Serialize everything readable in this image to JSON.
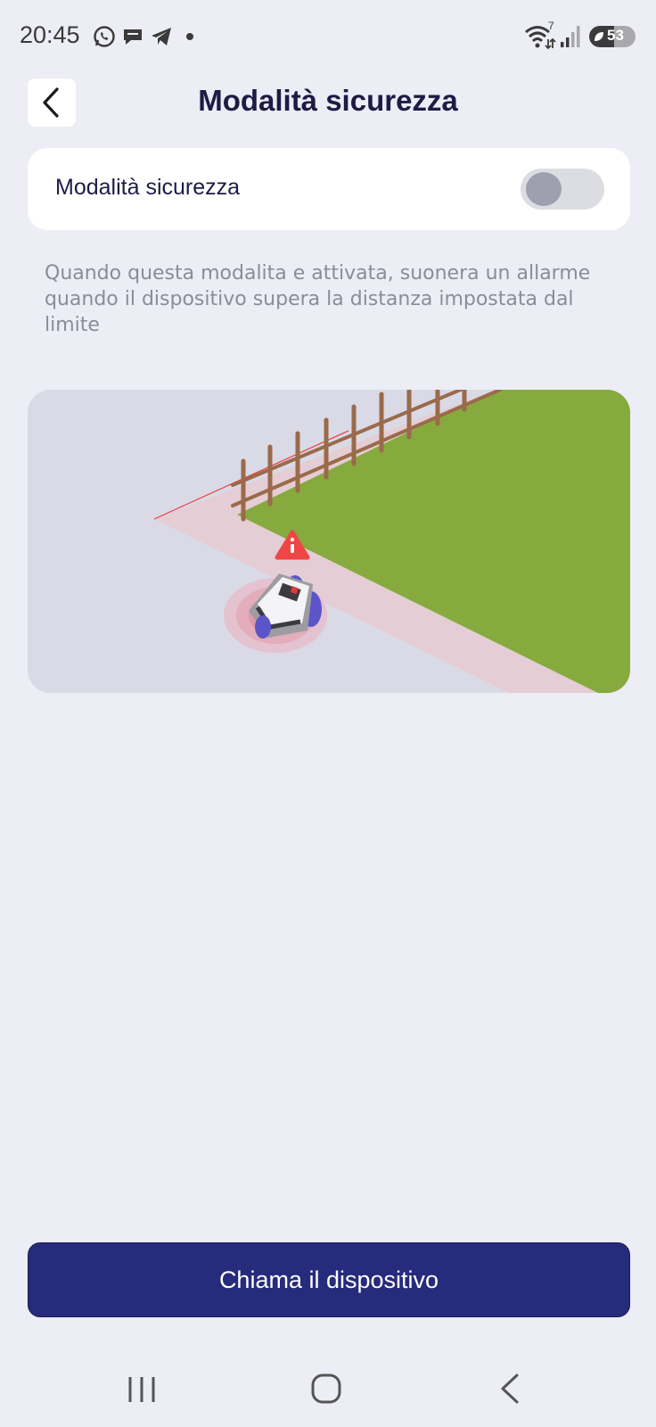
{
  "status_bar": {
    "time": "20:45",
    "notification_icons": [
      "whatsapp-icon",
      "chat-bubble-icon",
      "telegram-icon",
      "dot-icon"
    ],
    "wifi_badge": "7",
    "battery_percent": "53",
    "battery_level": 0.53
  },
  "header": {
    "back_icon": "chevron-left-icon",
    "title": "Modalità sicurezza"
  },
  "settings": {
    "toggle_label": "Modalità sicurezza",
    "toggle_on": false,
    "description": "Quando questa modalita e attivata, suonera un allarme quando il dispositivo supera la distanza impostata dal limite"
  },
  "illustration": {
    "lawn_color": "#86aa3e",
    "boundary_line_color": "#ef3a3a",
    "warning_icon": "warning-triangle-icon"
  },
  "actions": {
    "call_device_label": "Chiama il dispositivo"
  },
  "nav_bar": {
    "icons": [
      "recent-apps-icon",
      "home-icon",
      "back-icon"
    ]
  },
  "colors": {
    "background": "#ecedf5",
    "primary": "#262b7b",
    "title": "#1c1c44"
  }
}
